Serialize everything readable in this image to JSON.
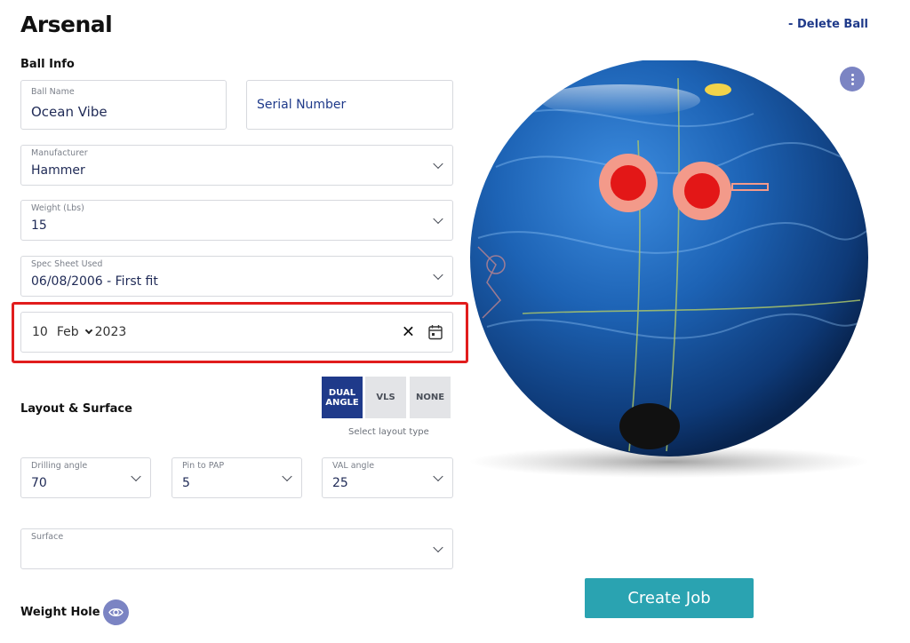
{
  "header": {
    "title": "Arsenal",
    "delete_label": "- Delete Ball"
  },
  "ball_info": {
    "section_label": "Ball Info",
    "ball_name": {
      "label": "Ball Name",
      "value": "Ocean Vibe"
    },
    "serial_number": {
      "placeholder": "Serial Number"
    },
    "manufacturer": {
      "label": "Manufacturer",
      "value": "Hammer"
    },
    "weight": {
      "label": "Weight (Lbs)",
      "value": "15"
    },
    "spec_sheet": {
      "label": "Spec Sheet Used",
      "value": "06/08/2006 - First fit"
    },
    "date": {
      "day": "10",
      "month": "Feb",
      "year": "2023",
      "clear_glyph": "✕"
    }
  },
  "layout_surface": {
    "section_label": "Layout & Surface",
    "layout_types": [
      {
        "label": "DUAL ANGLE",
        "active": true
      },
      {
        "label": "VLS",
        "active": false
      },
      {
        "label": "NONE",
        "active": false
      }
    ],
    "layout_hint": "Select layout type",
    "drilling_angle": {
      "label": "Drilling angle",
      "value": "70"
    },
    "pin_to_pap": {
      "label": "Pin to PAP",
      "value": "5"
    },
    "val_angle": {
      "label": "VAL angle",
      "value": "25"
    },
    "surface": {
      "label": "Surface",
      "value": ""
    }
  },
  "weight_hole": {
    "section_label": "Weight Hole",
    "icon": "eye-icon"
  },
  "actions": {
    "create_job_label": "Create Job"
  },
  "colors": {
    "primary": "#1f3a8a",
    "accent": "#2aa3b1",
    "highlight": "#e11d1d",
    "icon_button": "#7b84c3",
    "ball": "#1d63b5"
  }
}
